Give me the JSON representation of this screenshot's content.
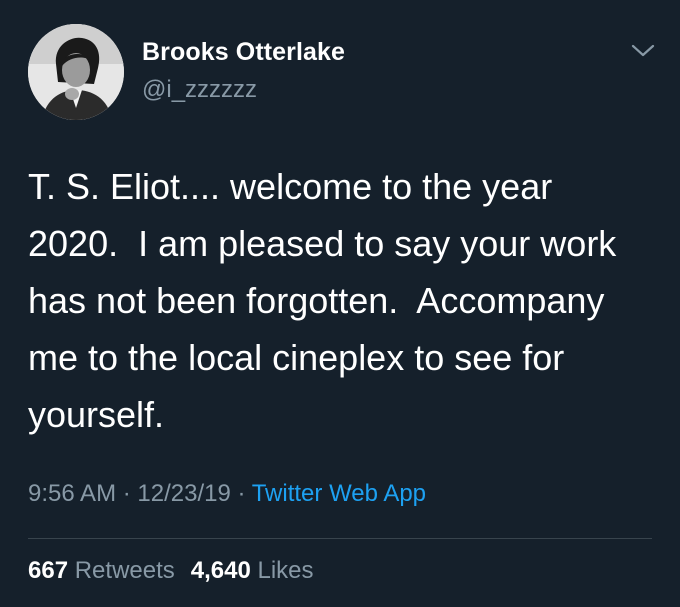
{
  "author": {
    "display_name": "Brooks Otterlake",
    "handle": "@i_zzzzzz"
  },
  "icons": {
    "caret": "chevron-down-icon",
    "avatar": "avatar"
  },
  "tweet": {
    "text": "T. S. Eliot.... welcome to the year\n2020.  I am pleased to say your work\nhas not been forgotten.  Accompany\nme to the local cineplex to see for\nyourself.",
    "time": "9:56 AM",
    "date": "12/23/19",
    "separator": " · ",
    "source": "Twitter Web App"
  },
  "stats": {
    "retweets_count": "667",
    "retweets_label": "Retweets",
    "likes_count": "4,640",
    "likes_label": "Likes"
  },
  "colors": {
    "background": "#15202b",
    "secondary_text": "#8899a6",
    "link": "#1da1f2",
    "divider": "#38444d"
  }
}
